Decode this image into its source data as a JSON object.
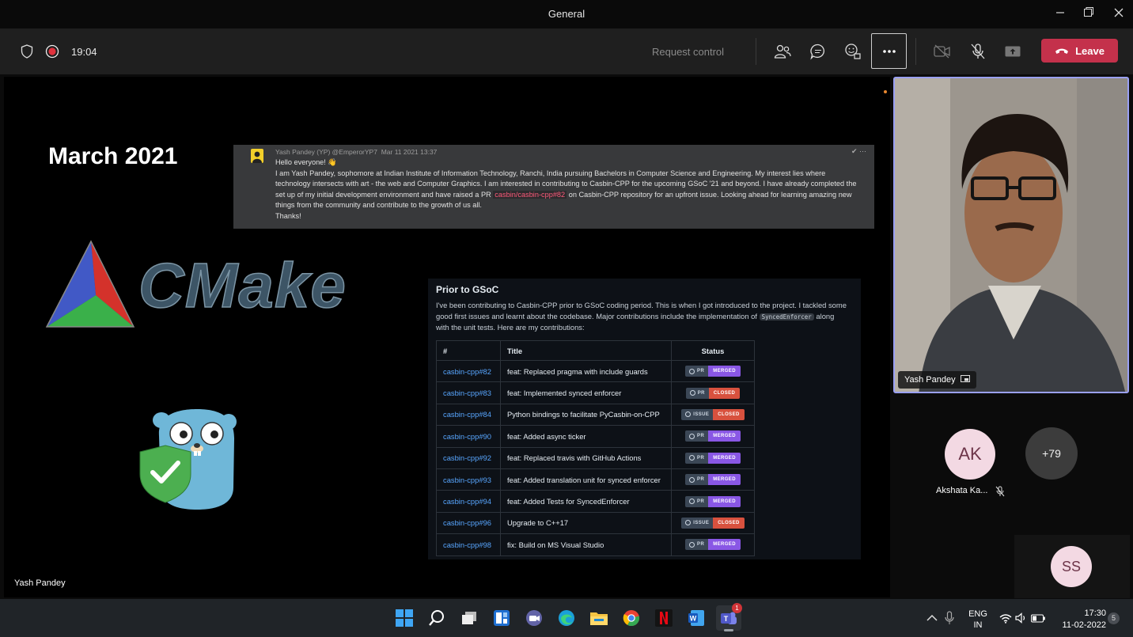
{
  "window": {
    "title": "General"
  },
  "toolbar": {
    "timer": "19:04",
    "request_control": "Request control",
    "leave": "Leave"
  },
  "slide": {
    "heading": "March 2021",
    "presenter_label": "Yash Pandey",
    "message": {
      "author": "Yash Pandey (YP) @EmperorYP7",
      "date": "Mar 11 2021 13:37",
      "greeting": "Hello everyone! 👋",
      "body_before": "I am Yash Pandey, sophomore at Indian Institute of Information Technology, Ranchi, India pursuing Bachelors in Computer Science and Engineering. My interest lies where technology intersects with art - the web and Computer Graphics. I am interested in contributing to Casbin-CPP for the upcoming GSoC '21 and beyond. I have already completed the set up of my initial development environment and have raised a PR ",
      "link": "casbin/casbin-cpp#82",
      "body_after": " on Casbin-CPP repository for an upfront issue. Looking ahead for learning amazing new things from the community and contribute to the growth of us all.",
      "closing": "Thanks!"
    },
    "logo_text": "CMake",
    "card": {
      "title": "Prior to GSoC",
      "intro_before": "I've been contributing to Casbin-CPP prior to GSoC coding period. This is when I got introduced to the project. I tackled some good first issues and learnt about the codebase. Major contributions include the implementation of ",
      "intro_code": "SyncedEnforcer",
      "intro_after": " along with the unit tests. Here are my contributions:",
      "headers": [
        "#",
        "Title",
        "Status"
      ],
      "rows": [
        {
          "id": "casbin-cpp#82",
          "title": "feat: Replaced pragma with include guards",
          "kind": "PR",
          "status": "MERGED"
        },
        {
          "id": "casbin-cpp#83",
          "title": "feat: Implemented synced enforcer",
          "kind": "PR",
          "status": "CLOSED"
        },
        {
          "id": "casbin-cpp#84",
          "title": "Python bindings to facilitate PyCasbin-on-CPP",
          "kind": "ISSUE",
          "status": "CLOSED"
        },
        {
          "id": "casbin-cpp#90",
          "title": "feat: Added async ticker",
          "kind": "PR",
          "status": "MERGED"
        },
        {
          "id": "casbin-cpp#92",
          "title": "feat: Replaced travis with GitHub Actions",
          "kind": "PR",
          "status": "MERGED"
        },
        {
          "id": "casbin-cpp#93",
          "title": "feat: Added translation unit for synced enforcer",
          "kind": "PR",
          "status": "MERGED"
        },
        {
          "id": "casbin-cpp#94",
          "title": "feat: Added Tests for SyncedEnforcer",
          "kind": "PR",
          "status": "MERGED"
        },
        {
          "id": "casbin-cpp#96",
          "title": "Upgrade to C++17",
          "kind": "ISSUE",
          "status": "CLOSED"
        },
        {
          "id": "casbin-cpp#98",
          "title": "fix: Build on MS Visual Studio",
          "kind": "PR",
          "status": "MERGED"
        }
      ]
    }
  },
  "participants": {
    "video_name": "Yash Pandey",
    "ak_initials": "AK",
    "ak_name": "Akshata Ka...",
    "more": "+79",
    "ss_initials": "SS"
  },
  "taskbar": {
    "lang1": "ENG",
    "lang2": "IN",
    "time": "17:30",
    "date": "11-02-2022",
    "teams_badge": "1",
    "notif": "5"
  },
  "colors": {
    "leave": "#c4314b",
    "accent": "#9aa0f5",
    "merged": "#8957e5",
    "closed": "#d8513e",
    "link": "#58a6ff"
  }
}
